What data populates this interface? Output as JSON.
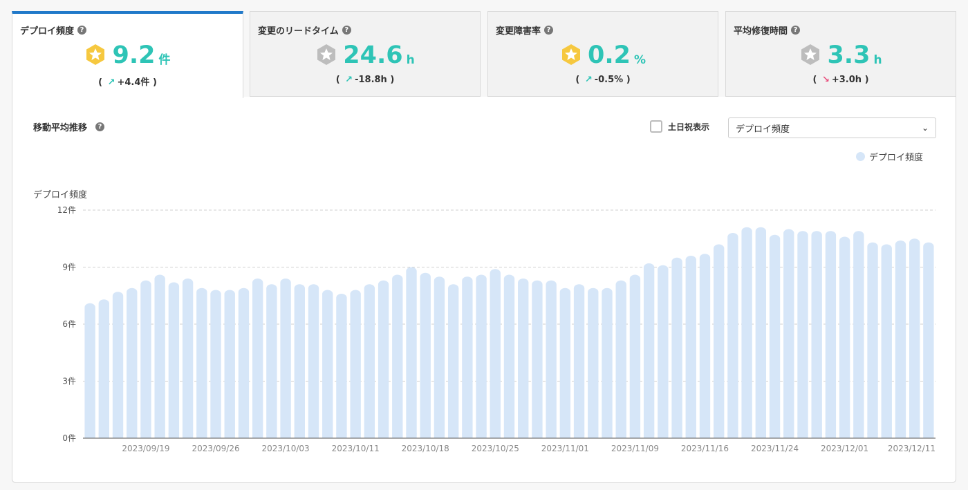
{
  "metrics": [
    {
      "title": "デプロイ頻度",
      "value": "9.2",
      "unit": "件",
      "delta": "+4.4件",
      "trend": "up",
      "badge": "gold-star-badge"
    },
    {
      "title": "変更のリードタイム",
      "value": "24.6",
      "unit": "h",
      "delta": "-18.8h",
      "trend": "up",
      "badge": "silver-star-badge"
    },
    {
      "title": "変更障害率",
      "value": "0.2",
      "unit": "%",
      "delta": "-0.5%",
      "trend": "up",
      "badge": "gold-star-badge"
    },
    {
      "title": "平均修復時間",
      "value": "3.3",
      "unit": "h",
      "delta": "+3.0h",
      "trend": "down",
      "badge": "silver-star-badge"
    }
  ],
  "panel": {
    "title": "移動平均推移",
    "holiday_label": "土日祝表示",
    "select_value": "デプロイ頻度",
    "legend": "デプロイ頻度"
  },
  "symbols": {
    "open": "(",
    "close": ")",
    "up": "↗",
    "down": "↘",
    "help": "?",
    "chevron": "⌄"
  },
  "colors": {
    "accent": "#2ec4b6",
    "tab_active": "#2179c9",
    "bar": "#d6e6f8",
    "gold": "#f6c83f",
    "silver": "#bdbdbd",
    "down": "#e94b7b"
  },
  "chart_data": {
    "type": "bar",
    "ylabel": "デプロイ頻度",
    "ylim": [
      0,
      12
    ],
    "yticks": [
      "0件",
      "3件",
      "6件",
      "9件",
      "12件"
    ],
    "ytick_values": [
      0,
      3,
      6,
      9,
      12
    ],
    "xtick_labels": [
      "2023/09/19",
      "2023/09/26",
      "2023/10/03",
      "2023/10/11",
      "2023/10/18",
      "2023/10/25",
      "2023/11/01",
      "2023/11/09",
      "2023/11/16",
      "2023/11/24",
      "2023/12/01",
      "2023/12/11"
    ],
    "xtick_bar_index": [
      4,
      9,
      14,
      19,
      24,
      29,
      34,
      39,
      44,
      49,
      54,
      59
    ],
    "grid": true,
    "legend_position": "top-right",
    "series": [
      {
        "name": "デプロイ頻度",
        "values": [
          7.1,
          7.3,
          7.7,
          7.9,
          8.3,
          8.6,
          8.2,
          8.4,
          7.9,
          7.8,
          7.8,
          7.9,
          8.4,
          8.1,
          8.4,
          8.1,
          8.1,
          7.8,
          7.6,
          7.8,
          8.1,
          8.3,
          8.6,
          9.0,
          8.7,
          8.5,
          8.1,
          8.5,
          8.6,
          8.9,
          8.6,
          8.4,
          8.3,
          8.3,
          7.9,
          8.1,
          7.9,
          7.9,
          8.3,
          8.6,
          9.2,
          9.1,
          9.5,
          9.6,
          9.7,
          10.2,
          10.8,
          11.1,
          11.1,
          10.7,
          11.0,
          10.9,
          10.9,
          10.9,
          10.6,
          10.9,
          10.3,
          10.2,
          10.4,
          10.5,
          10.3
        ]
      }
    ]
  }
}
